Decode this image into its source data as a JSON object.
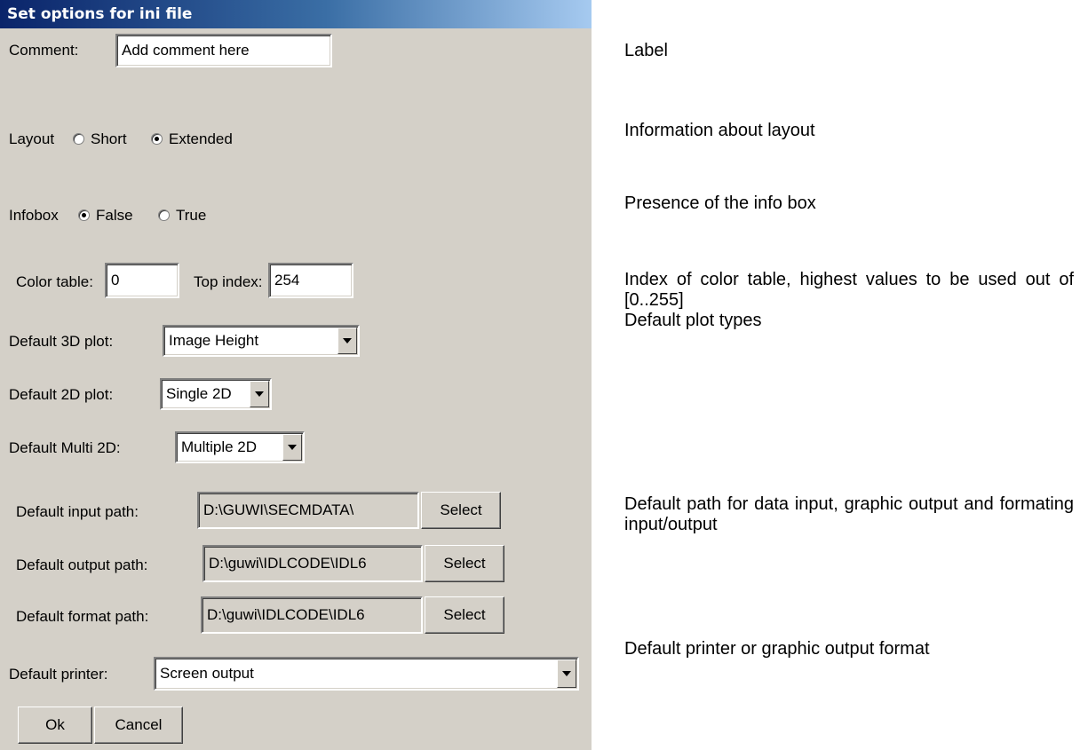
{
  "window": {
    "title": "Set options for ini file"
  },
  "comment": {
    "label": "Comment:",
    "value": "Add comment here"
  },
  "layout": {
    "label": "Layout",
    "options": [
      "Short",
      "Extended"
    ],
    "selected": "Extended"
  },
  "infobox": {
    "label": "Infobox",
    "options": [
      "False",
      "True"
    ],
    "selected": "False"
  },
  "color_table": {
    "label": "Color table:",
    "value": "0"
  },
  "top_index": {
    "label": "Top index:",
    "value": "254"
  },
  "default_3d": {
    "label": "Default 3D plot:",
    "value": "Image Height"
  },
  "default_2d": {
    "label": "Default 2D plot:",
    "value": "Single 2D"
  },
  "default_multi_2d": {
    "label": "Default Multi 2D:",
    "value": "Multiple 2D"
  },
  "input_path": {
    "label": "Default input path:",
    "value": "D:\\GUWI\\SECMDATA\\",
    "button": "Select"
  },
  "output_path": {
    "label": "Default output path:",
    "value": "D:\\guwi\\IDLCODE\\IDL6",
    "button": "Select"
  },
  "format_path": {
    "label": "Default format path:",
    "value": "D:\\guwi\\IDLCODE\\IDL6",
    "button": "Select"
  },
  "printer": {
    "label": "Default printer:",
    "value": "Screen output"
  },
  "buttons": {
    "ok": "Ok",
    "cancel": "Cancel"
  },
  "annotations": {
    "label": "Label",
    "layout": "Information about layout",
    "infobox": "Presence of the info box",
    "color_table": "Index of color table, highest values to be used out of [0..255]",
    "plot_types": "Default plot types",
    "paths": "Default path for data input, graphic output and formating input/output",
    "printer": "Default printer or graphic output format"
  }
}
